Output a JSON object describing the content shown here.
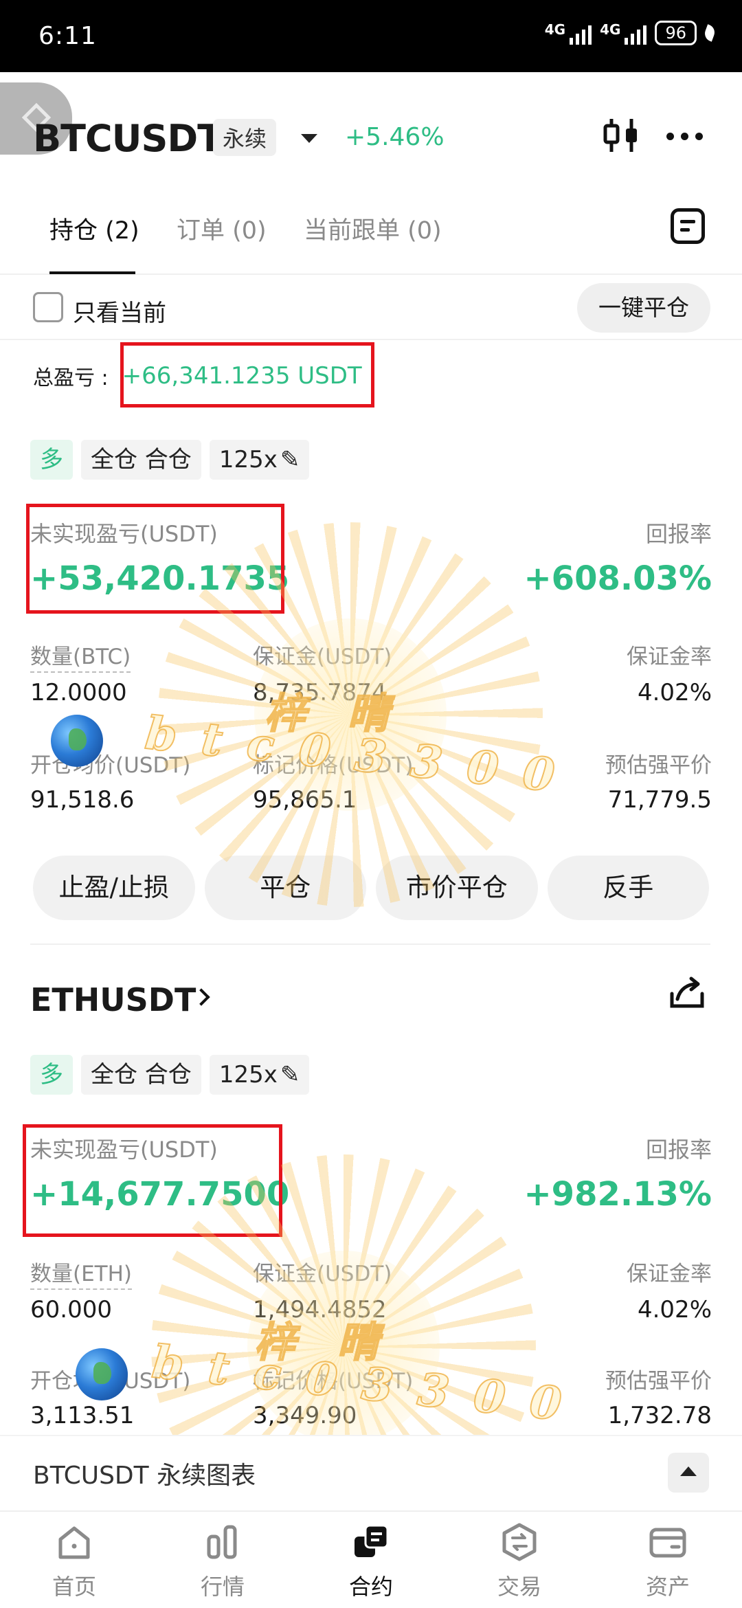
{
  "status_bar": {
    "time": "6:11",
    "network1": "4G",
    "network2": "4G",
    "battery": "96"
  },
  "header": {
    "symbol": "BTCUSDT",
    "contract_type": "永续",
    "change_pct": "+5.46%"
  },
  "tabs": [
    {
      "label": "持仓 (2)",
      "active": true
    },
    {
      "label": "订单 (0)",
      "active": false
    },
    {
      "label": "当前跟单 (0)",
      "active": false
    }
  ],
  "filter": {
    "only_current_label": "只看当前",
    "close_all_label": "一键平仓"
  },
  "total_pnl": {
    "label": "总盈亏 :",
    "value": "+66,341.1235 USDT"
  },
  "positions": [
    {
      "side": "多",
      "margin_mode": "全仓 合仓",
      "leverage": "125x",
      "unrealized_label": "未实现盈亏(USDT)",
      "unrealized_value": "+53,420.1735",
      "roe_label": "回报率",
      "roe_value": "+608.03%",
      "qty_label": "数量(BTC)",
      "qty_value": "12.0000",
      "margin_label": "保证金(USDT)",
      "margin_value": "8,735.7874",
      "margin_rate_label": "保证金率",
      "margin_rate_value": "4.02%",
      "entry_label": "开仓均价(USDT)",
      "entry_value": "91,518.6",
      "mark_label": "标记价格(USDT)",
      "mark_value": "95,865.1",
      "liq_label": "预估强平价",
      "liq_value": "71,779.5",
      "actions": [
        "止盈/止损",
        "平仓",
        "市价平仓",
        "反手"
      ]
    },
    {
      "symbol": "ETHUSDT",
      "side": "多",
      "margin_mode": "全仓 合仓",
      "leverage": "125x",
      "unrealized_label": "未实现盈亏(USDT)",
      "unrealized_value": "+14,677.7500",
      "roe_label": "回报率",
      "roe_value": "+982.13%",
      "qty_label": "数量(ETH)",
      "qty_value": "60.000",
      "margin_label": "保证金(USDT)",
      "margin_value": "1,494.4852",
      "margin_rate_label": "保证金率",
      "margin_rate_value": "4.02%",
      "entry_label": "开仓均价(USDT)",
      "entry_value": "3,113.51",
      "mark_label": "标记价格(USDT)",
      "mark_value": "3,349.90",
      "liq_label": "预估强平价",
      "liq_value": "1,732.78"
    }
  ],
  "watermarks": {
    "name": "梓 晴",
    "id": "btc03300"
  },
  "chart_bar": {
    "label": "BTCUSDT 永续图表"
  },
  "bottom_nav": [
    {
      "label": "首页",
      "icon": "home-icon"
    },
    {
      "label": "行情",
      "icon": "market-icon"
    },
    {
      "label": "合约",
      "icon": "futures-icon",
      "active": true
    },
    {
      "label": "交易",
      "icon": "trade-icon"
    },
    {
      "label": "资产",
      "icon": "wallet-icon"
    }
  ],
  "colors": {
    "profit": "#2ebd85",
    "highlight_box": "#e5141d",
    "watermark": "#f0b44a"
  }
}
